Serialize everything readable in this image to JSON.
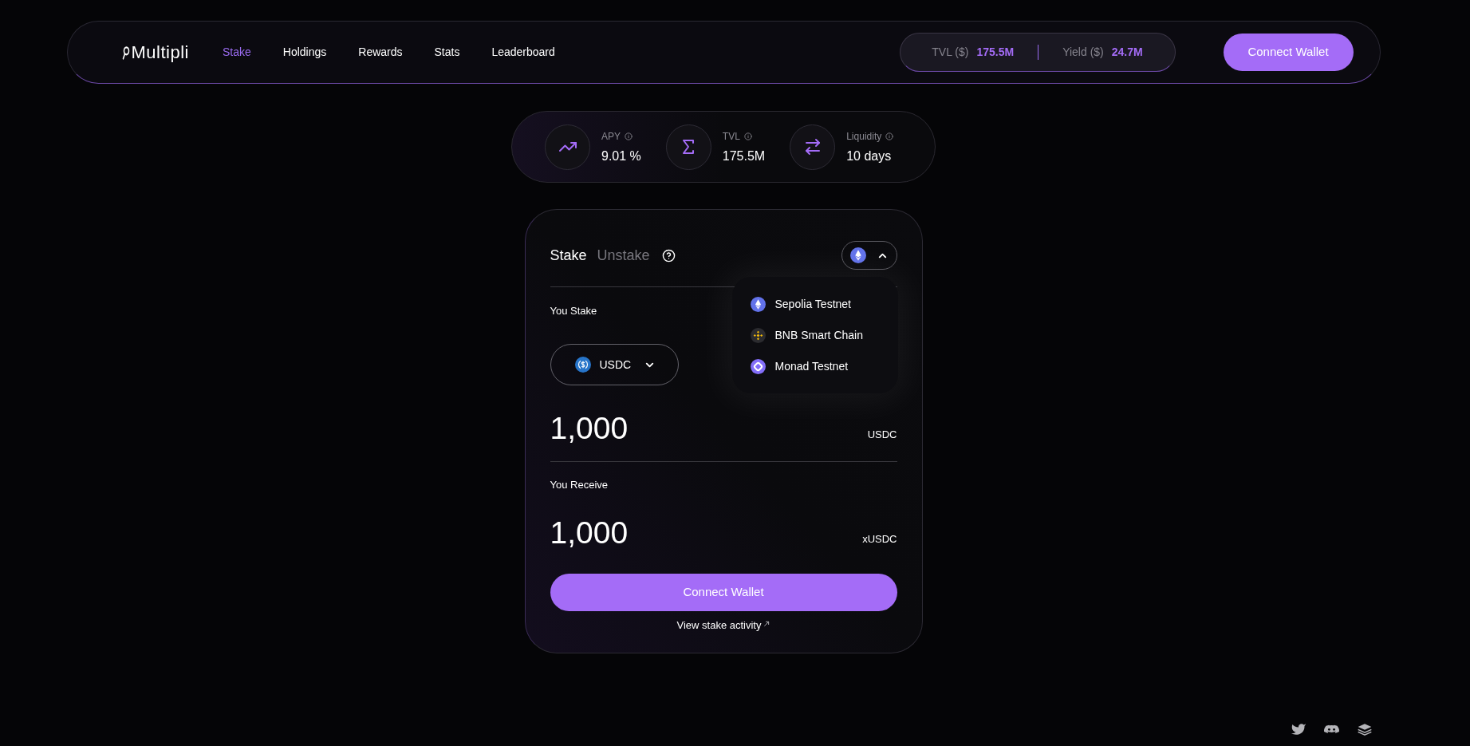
{
  "header": {
    "logo": "Multipli",
    "nav": [
      {
        "label": "Stake",
        "selected": true
      },
      {
        "label": "Holdings",
        "selected": false
      },
      {
        "label": "Rewards",
        "selected": false
      },
      {
        "label": "Stats",
        "selected": false
      },
      {
        "label": "Leaderboard",
        "selected": false
      }
    ],
    "stats": [
      {
        "label": "TVL ($)",
        "value": "175.5M"
      },
      {
        "label": "Yield ($)",
        "value": "24.7M"
      }
    ],
    "connect_button": "Connect Wallet"
  },
  "metrics": [
    {
      "label": "APY",
      "value": "9.01 %"
    },
    {
      "label": "TVL",
      "value": "175.5M"
    },
    {
      "label": "Liquidity",
      "value": "10 days"
    }
  ],
  "stake_panel": {
    "tabs": [
      {
        "label": "Stake",
        "selected": true
      },
      {
        "label": "Unstake",
        "selected": false
      }
    ],
    "network_menu": {
      "expanded": true,
      "options": [
        {
          "label": "Sepolia Testnet",
          "selected": true
        },
        {
          "label": "BNB Smart Chain",
          "selected": false
        },
        {
          "label": "Monad Testnet",
          "selected": false
        }
      ]
    },
    "you_stake": {
      "label": "You Stake",
      "token": "USDC",
      "amount": "1,000",
      "unit": "USDC"
    },
    "you_receive": {
      "label": "You Receive",
      "amount": "1,000",
      "unit": "xUSDC"
    },
    "connect_button": "Connect Wallet",
    "activity_link": "View stake activity"
  }
}
